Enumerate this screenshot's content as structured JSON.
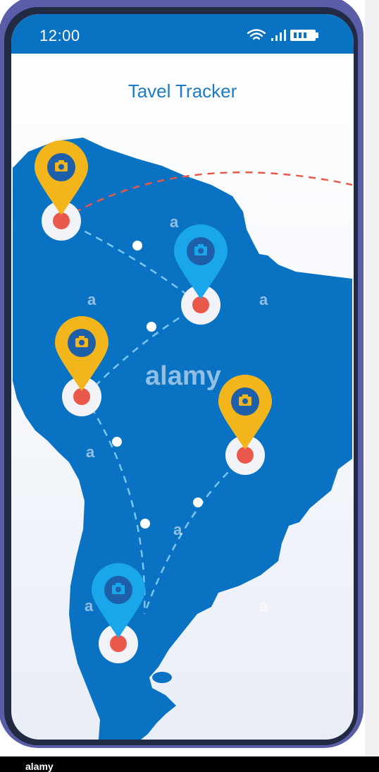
{
  "status_bar": {
    "time": "12:00",
    "icons": [
      "wifi-icon",
      "signal-icon",
      "battery-icon"
    ]
  },
  "app": {
    "title": "Tavel Tracker"
  },
  "map": {
    "region": "South America",
    "markers": [
      {
        "name": "marker-north-west",
        "color": "#f2b51c",
        "icon": "camera-icon"
      },
      {
        "name": "marker-north-center",
        "color": "#1aa6ea",
        "icon": "camera-icon"
      },
      {
        "name": "marker-west-middle",
        "color": "#f2b51c",
        "icon": "camera-icon"
      },
      {
        "name": "marker-east-middle",
        "color": "#f2b51c",
        "icon": "camera-icon"
      },
      {
        "name": "marker-south",
        "color": "#1aa6ea",
        "icon": "camera-icon"
      }
    ]
  },
  "watermark": {
    "main": "alamy",
    "small": "a"
  },
  "colors": {
    "status_bar": "#0a72c2",
    "continent": "#0a72c2",
    "frame": "#5a5ea9",
    "pin_yellow": "#f2b51c",
    "pin_blue": "#1aa6ea",
    "dot_red": "#e9584b",
    "title": "#1f7ac4"
  },
  "footer": {
    "text": "alamy"
  }
}
